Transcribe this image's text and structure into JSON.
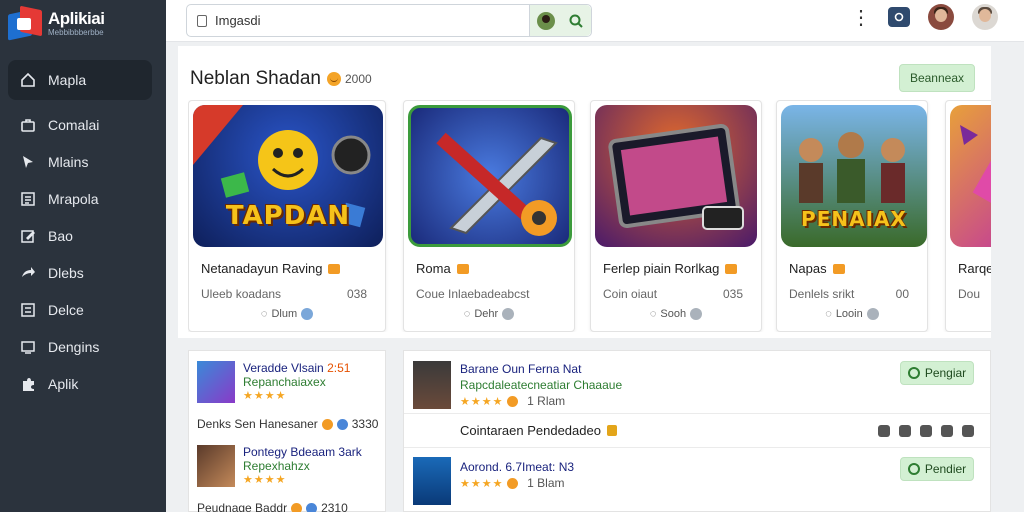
{
  "app": {
    "title": "Aplikiai",
    "subtitle": "Mebbibbberbbe"
  },
  "sidebar": {
    "items": [
      {
        "label": "Mapla",
        "icon": "home-icon"
      },
      {
        "label": "Comalai",
        "icon": "briefcase-icon"
      },
      {
        "label": "Mlains",
        "icon": "pointer-icon"
      },
      {
        "label": "Mrapola",
        "icon": "list-icon"
      },
      {
        "label": "Bao",
        "icon": "edit-icon"
      },
      {
        "label": "Dlebs",
        "icon": "share-icon"
      },
      {
        "label": "Delce",
        "icon": "grid-icon"
      },
      {
        "label": "Dengins",
        "icon": "screen-icon"
      },
      {
        "label": "Aplik",
        "icon": "puzzle-icon"
      }
    ]
  },
  "search": {
    "value": "Imgasdi"
  },
  "section": {
    "title": "Neblan Shadan",
    "count": "2000",
    "button": "Beanneax"
  },
  "cards": [
    {
      "name": "Netanadayun Raving",
      "meta_left": "Uleeb koadans",
      "meta_right": "038",
      "foot": "Dlum",
      "art_label": "TAPDAN"
    },
    {
      "name": "Roma",
      "meta_left": "Coue Inlaebadeabcst",
      "meta_right": "",
      "foot": "Dehr",
      "art_label": ""
    },
    {
      "name": "Ferlep piain Rorlkag",
      "meta_left": "Coin oiaut",
      "meta_right": "035",
      "foot": "Sooh",
      "art_label": ""
    },
    {
      "name": "Napas",
      "meta_left": "Denlels srikt",
      "meta_right": "00",
      "foot": "Looin",
      "art_label": "PENAIAX"
    },
    {
      "name": "Rarqe",
      "meta_left": "Dou",
      "meta_right": "",
      "foot": "",
      "art_label": ""
    }
  ],
  "lower_left": {
    "items": [
      {
        "title": "Veradde Vlsain",
        "badge": "2:51",
        "sub": "Repanchaiaxex",
        "stars": "★★★★"
      },
      {
        "title": "Pontegy Bdeaam",
        "badge": "3ark",
        "sub": "Repexhahzx",
        "stars": "★★★★"
      }
    ],
    "lines": [
      {
        "text": "Denks Sen Hanesaner",
        "num": "3330"
      },
      {
        "text": "Peudnage Baddr",
        "num": "2310"
      }
    ]
  },
  "lower_right": {
    "rows": [
      {
        "title": "Barane Oun Ferna  Nat",
        "sub": "Rapcdaleatecneatiar Chaaaue",
        "stars": "★★★★",
        "meta": "1 Rlam",
        "button": "Pengiar"
      },
      {
        "title": "Aorond. 6.7Imeat: N3",
        "sub": "",
        "stars": "★★★★",
        "meta": "1 Blam",
        "button": "Pendier"
      }
    ],
    "middle": "Cointaraen Pendedadeo"
  },
  "colors": {
    "sidebar": "#2b333d",
    "accent_green": "#d3f0d3",
    "link_blue": "#1a237e"
  }
}
